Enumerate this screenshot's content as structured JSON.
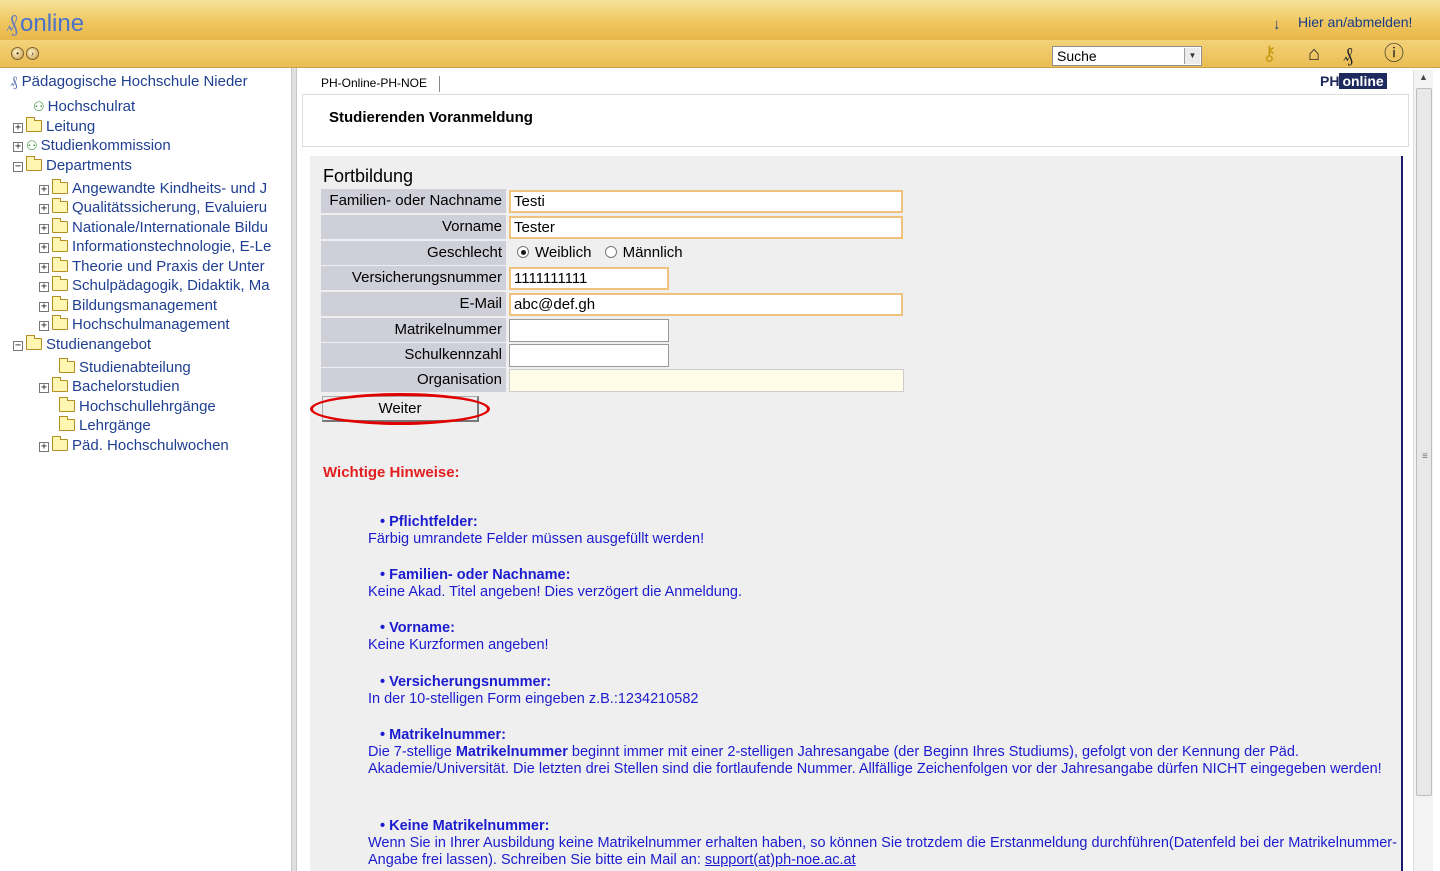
{
  "header": {
    "logo_text": "online",
    "login_link": "Hier an/abmelden!",
    "search_select": "Suche"
  },
  "sidebar": {
    "root": "Pädagogische Hochschule Nieder",
    "items": [
      {
        "label": "Hochschulrat"
      },
      {
        "label": "Leitung"
      },
      {
        "label": "Studienkommission"
      },
      {
        "label": "Departments"
      },
      {
        "label": "Angewandte Kindheits- und J"
      },
      {
        "label": "Qualitätssicherung, Evaluieru"
      },
      {
        "label": "Nationale/Internationale Bildu"
      },
      {
        "label": "Informationstechnologie, E-Le"
      },
      {
        "label": "Theorie und Praxis der Unter"
      },
      {
        "label": "Schulpädagogik, Didaktik, Ma"
      },
      {
        "label": "Bildungsmanagement"
      },
      {
        "label": "Hochschulmanagement"
      },
      {
        "label": "Studienangebot"
      },
      {
        "label": "Studienabteilung"
      },
      {
        "label": "Bachelorstudien"
      },
      {
        "label": "Hochschullehrgänge"
      },
      {
        "label": "Lehrgänge"
      },
      {
        "label": "Päd. Hochschulwochen"
      }
    ]
  },
  "main": {
    "breadcrumb": "PH-Online-PH-NOE",
    "logo_ph": "PH",
    "logo_online": "online",
    "page_title": "Studierenden Voranmeldung",
    "form_heading": "Fortbildung",
    "fields": {
      "nachname_label": "Familien- oder Nachname",
      "nachname_value": "Testi",
      "vorname_label": "Vorname",
      "vorname_value": "Tester",
      "geschlecht_label": "Geschlecht",
      "geschlecht_weiblich": "Weiblich",
      "geschlecht_maennlich": "Männlich",
      "versicherung_label": "Versicherungsnummer",
      "versicherung_value": "1111111111",
      "email_label": "E-Mail",
      "email_value": "abc@def.gh",
      "matrikel_label": "Matrikelnummer",
      "matrikel_value": "",
      "schulkennzahl_label": "Schulkennzahl",
      "schulkennzahl_value": "",
      "organisation_label": "Organisation",
      "organisation_value": ""
    },
    "submit_label": "Weiter",
    "notes_title": "Wichtige Hinweise:",
    "notes": [
      {
        "title": "Pflichtfelder:",
        "text": "Färbig umrandete Felder müssen ausgefüllt werden!"
      },
      {
        "title": "Familien- oder Nachname:",
        "text": "Keine Akad. Titel angeben! Dies verzögert die Anmeldung."
      },
      {
        "title": "Vorname:",
        "text": "Keine Kurzformen angeben!"
      },
      {
        "title": "Versicherungsnummer:",
        "text": "In der 10-stelligen Form eingeben z.B.:1234210582"
      },
      {
        "title": "Matrikelnummer:",
        "text_a": "Die 7-stellige ",
        "text_bold": "Matrikelnummer",
        "text_b": " beginnt immer mit einer 2-stelligen Jahresangabe (der Beginn Ihres Studiums), gefolgt von der Kennung der Päd. Akademie/Universität. Die letzten drei Stellen sind die fortlaufende Nummer. Allfällige Zeichenfolgen vor der Jahresangabe dürfen NICHT eingegeben werden!"
      },
      {
        "title": "Keine Matrikelnummer:",
        "text": "Wenn Sie in Ihrer Ausbildung keine Matrikelnummer erhalten haben, so können Sie trotzdem die Erstanmeldung durchführen(Datenfeld bei der Matrikelnummer-Angabe frei lassen). Schreiben Sie bitte ein Mail an: ",
        "email": "support(at)ph-noe.ac.at"
      }
    ]
  }
}
